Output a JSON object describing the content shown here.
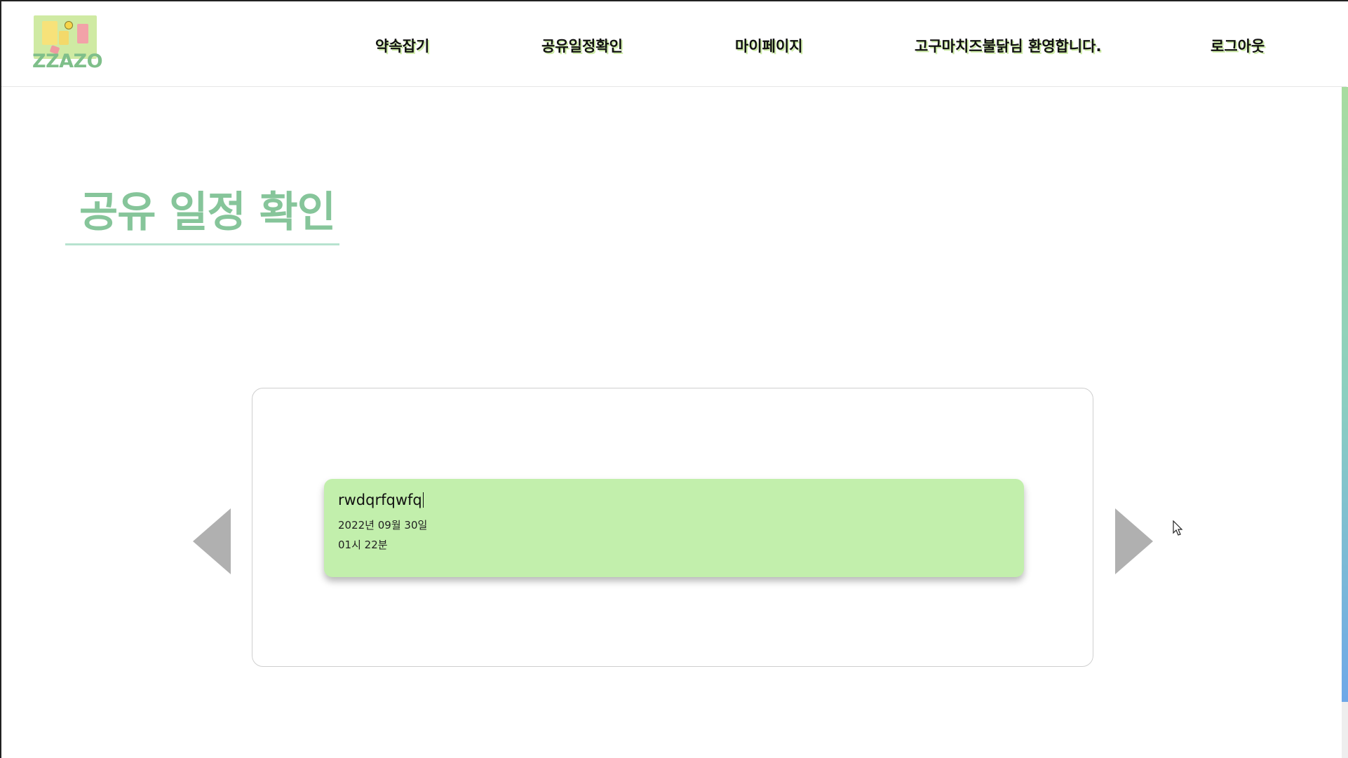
{
  "logo": {
    "text": "ZZAZO"
  },
  "nav": {
    "items": [
      {
        "label": "약속잡기"
      },
      {
        "label": "공유일정확인"
      },
      {
        "label": "마이페이지"
      },
      {
        "label": "고구마치즈불닭님 환영합니다."
      },
      {
        "label": "로그아웃"
      }
    ]
  },
  "page": {
    "title": "공유 일정 확인"
  },
  "schedule": {
    "title": "rwdqrfqwfq",
    "date": "2022년 09월 30일",
    "time": "01시 22분"
  },
  "colors": {
    "accent_green": "#86c59a",
    "card_green": "#c2efac",
    "nav_shadow": "#cdeba6",
    "arrow_gray": "#b0b0b0"
  },
  "icons": {
    "prev": "triangle-left-icon",
    "next": "triangle-right-icon",
    "cursor": "mouse-pointer-icon"
  }
}
